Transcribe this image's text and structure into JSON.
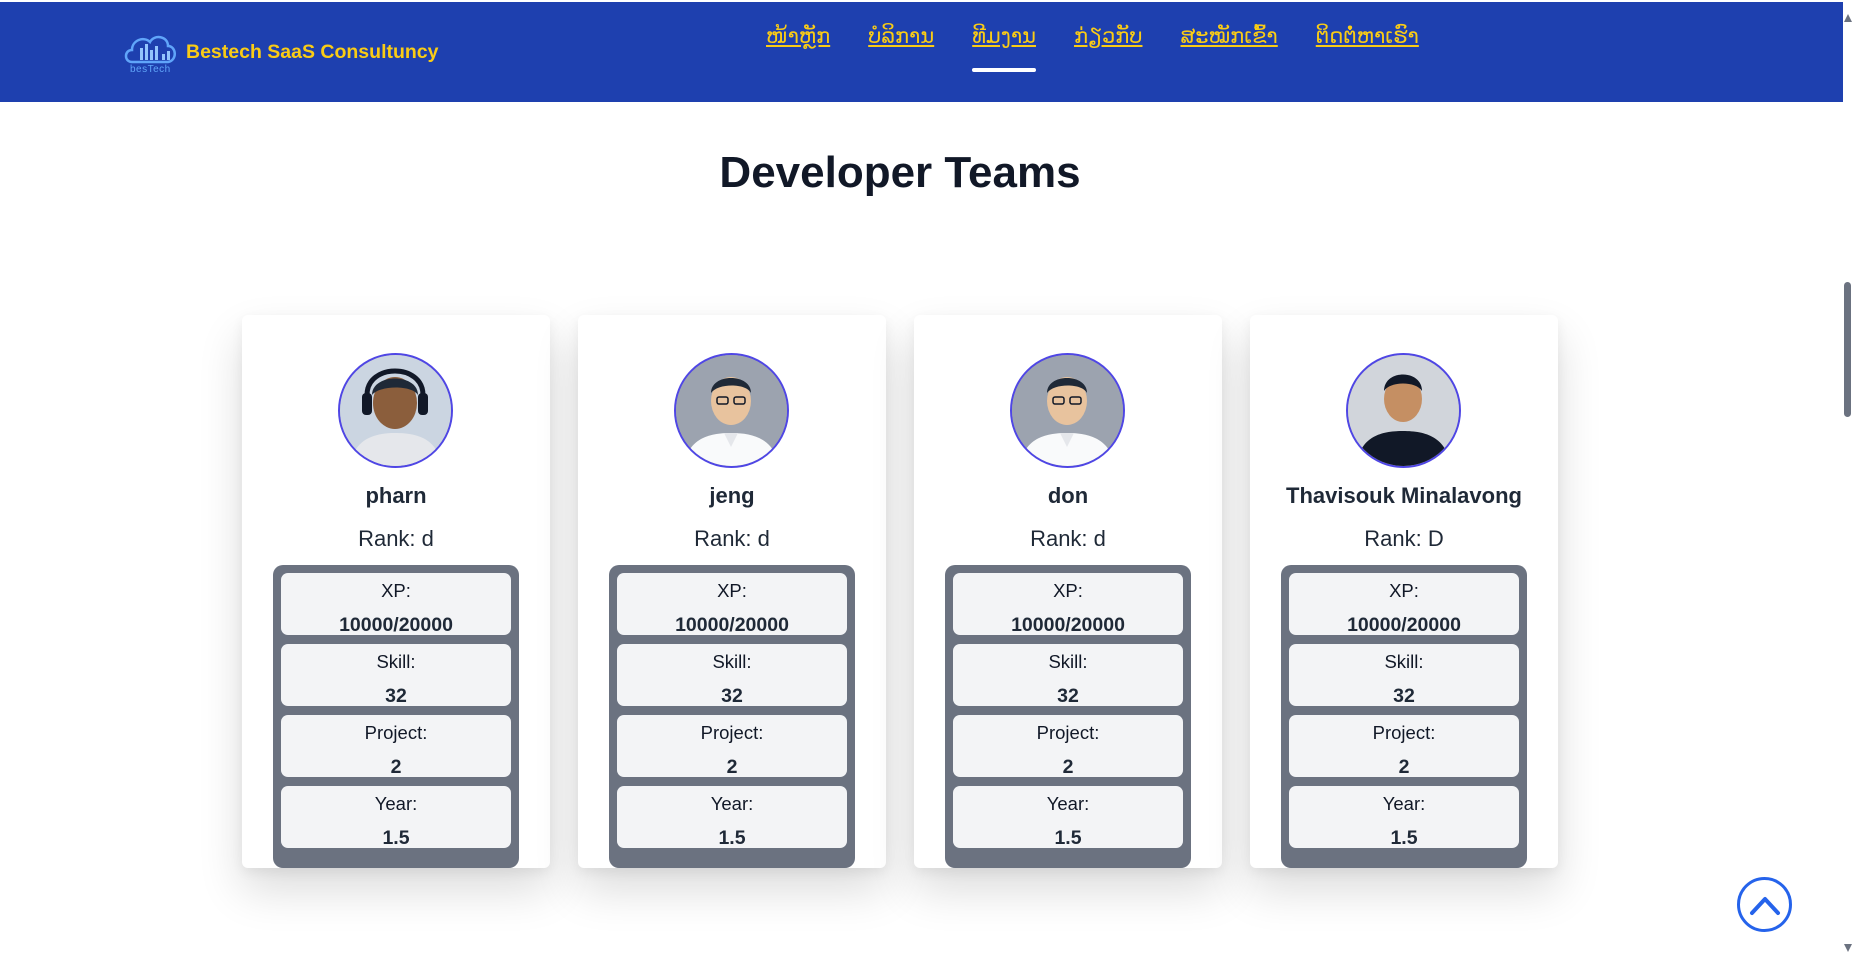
{
  "brand": {
    "name": "Bestech SaaS Consultuncy",
    "logo_text": "besTech"
  },
  "nav": {
    "items": [
      {
        "label": "ໜ້າຫຼັກ",
        "active": false
      },
      {
        "label": "ບໍລິການ",
        "active": false
      },
      {
        "label": "ທີມງານ",
        "active": true
      },
      {
        "label": "ກ່ຽວກັບ",
        "active": false
      },
      {
        "label": "ສະໝັກເຂົ້າ",
        "active": false
      },
      {
        "label": "ຕິດຕໍ່ຫາເຮົາ",
        "active": false
      }
    ]
  },
  "section": {
    "title": "Developer Teams"
  },
  "members": [
    {
      "name": "pharn",
      "rank": "Rank: d",
      "stats": [
        {
          "label": "XP:",
          "value": "10000/20000"
        },
        {
          "label": "Skill:",
          "value": "32"
        },
        {
          "label": "Project:",
          "value": "2"
        },
        {
          "label": "Year:",
          "value": "1.5"
        }
      ]
    },
    {
      "name": "jeng",
      "rank": "Rank: d",
      "stats": [
        {
          "label": "XP:",
          "value": "10000/20000"
        },
        {
          "label": "Skill:",
          "value": "32"
        },
        {
          "label": "Project:",
          "value": "2"
        },
        {
          "label": "Year:",
          "value": "1.5"
        }
      ]
    },
    {
      "name": "don",
      "rank": "Rank: d",
      "stats": [
        {
          "label": "XP:",
          "value": "10000/20000"
        },
        {
          "label": "Skill:",
          "value": "32"
        },
        {
          "label": "Project:",
          "value": "2"
        },
        {
          "label": "Year:",
          "value": "1.5"
        }
      ]
    },
    {
      "name": "Thavisouk Minalavong",
      "rank": "Rank: D",
      "stats": [
        {
          "label": "XP:",
          "value": "10000/20000"
        },
        {
          "label": "Skill:",
          "value": "32"
        },
        {
          "label": "Project:",
          "value": "2"
        },
        {
          "label": "Year:",
          "value": "1.5"
        }
      ]
    }
  ],
  "icons": {
    "scroll_top": "chevron-up-circle-icon",
    "logo": "cloud-chart-logo-icon"
  },
  "colors": {
    "header_bg": "#1e40af",
    "brand_text": "#facc15",
    "avatar_border": "#4f46e5",
    "stats_bg": "#6b7280",
    "stat_cell_bg": "#f3f4f6",
    "scroll_top": "#2563eb"
  }
}
